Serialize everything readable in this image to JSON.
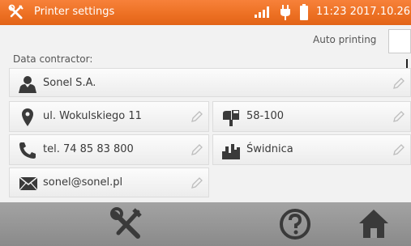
{
  "status_bar": {
    "title": "Printer settings",
    "clock": "11:23 2017.10.26",
    "icons": [
      "settings-tools-icon",
      "signal-icon",
      "plug-icon",
      "battery-icon"
    ]
  },
  "auto_printing": {
    "label": "Auto printing",
    "value": ""
  },
  "data_contractor": {
    "label": "Data contractor:",
    "name": "Sonel S.A.",
    "street": "ul. Wokulskiego 11",
    "postcode": "58-100",
    "phone": "tel. 74 85 83 800",
    "city": "Świdnica",
    "email": "sonel@sonel.pl"
  },
  "bottom_bar": {
    "buttons": [
      "settings",
      "help",
      "home"
    ]
  },
  "colors": {
    "header": "#ec6f22",
    "bottom_bar": "#999999",
    "background": "#f2f2f2"
  }
}
